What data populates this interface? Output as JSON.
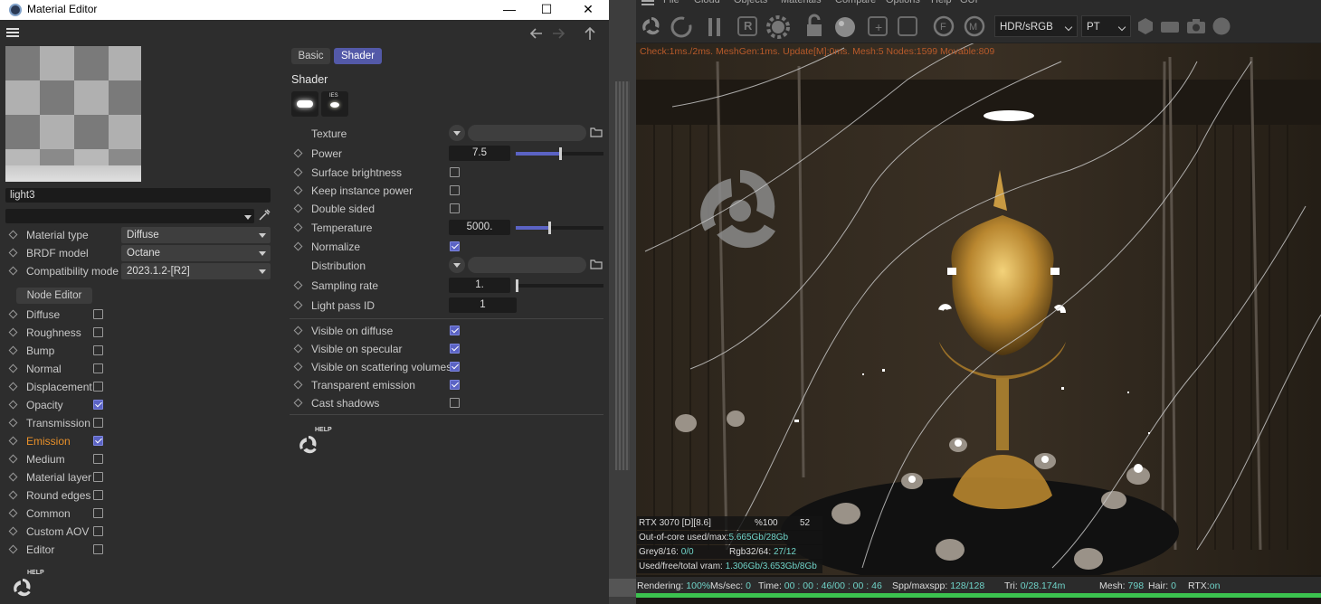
{
  "material_editor": {
    "title": "Material Editor",
    "name_value": "light3",
    "material_type_label": "Material type",
    "material_type_value": "Diffuse",
    "brdf_label": "BRDF model",
    "brdf_value": "Octane",
    "compat_label": "Compatibility mode",
    "compat_value": "2023.1.2-[R2]",
    "node_editor_label": "Node Editor",
    "channels": [
      {
        "label": "Diffuse",
        "checked": false
      },
      {
        "label": "Roughness",
        "checked": false
      },
      {
        "label": "Bump",
        "checked": false
      },
      {
        "label": "Normal",
        "checked": false
      },
      {
        "label": "Displacement",
        "checked": false
      },
      {
        "label": "Opacity",
        "checked": true
      },
      {
        "label": "Transmission",
        "checked": false
      },
      {
        "label": "Emission",
        "checked": true,
        "active": true
      },
      {
        "label": "Medium",
        "checked": false
      },
      {
        "label": "Material layer",
        "checked": false
      },
      {
        "label": "Round edges",
        "checked": false
      },
      {
        "label": "Common",
        "checked": false
      },
      {
        "label": "Custom AOV",
        "checked": false
      },
      {
        "label": "Editor",
        "checked": false
      }
    ],
    "help_label": "HELP",
    "tabs": {
      "basic": "Basic",
      "shader": "Shader"
    },
    "shader_heading": "Shader",
    "ies_label": "IES",
    "texture_label": "Texture",
    "power_label": "Power",
    "power_value": "7.5",
    "power_level": 0.5,
    "surface_brightness_label": "Surface brightness",
    "keep_instance_power_label": "Keep instance power",
    "double_sided_label": "Double sided",
    "temperature_label": "Temperature",
    "temperature_value": "5000.",
    "temperature_level": 0.38,
    "normalize_label": "Normalize",
    "distribution_label": "Distribution",
    "sampling_rate_label": "Sampling rate",
    "sampling_rate_value": "1.",
    "light_pass_label": "Light pass ID",
    "light_pass_value": "1",
    "visibility": [
      {
        "label": "Visible on diffuse",
        "checked": true
      },
      {
        "label": "Visible on specular",
        "checked": true
      },
      {
        "label": "Visible on scattering volumes",
        "checked": true
      },
      {
        "label": "Transparent emission",
        "checked": true
      },
      {
        "label": "Cast shadows",
        "checked": false
      }
    ],
    "accent_color": "#5b63c4",
    "emission_color": "#e8902a"
  },
  "viewer": {
    "menu": [
      "File",
      "Cloud",
      "Objects",
      "Materials",
      "Compare",
      "Options",
      "Help",
      "GUI"
    ],
    "color_space": "HDR/sRGB",
    "kernel": "PT",
    "status_line": "Check:1ms./2ms. MeshGen:1ms. Update[M]:0ms. Mesh:5 Nodes:1599 Movable:809",
    "gpu": "RTX 3070 [D][8.6]",
    "gpu_percent": "%100",
    "gpu_temp": "52",
    "out_of_core_label": "Out-of-core used/max:",
    "out_of_core_value": "5.665Gb/28Gb",
    "grey_label": "Grey8/16:",
    "grey_value": "0/0",
    "rgb_label": "Rgb32/64:",
    "rgb_value": "27/12",
    "vram_label": "Used/free/total vram:",
    "vram_value": "1.306Gb/3.653Gb/8Gb",
    "rendering_label": "Rendering:",
    "rendering_value": "100%",
    "ms_label": "Ms/sec:",
    "ms_value": "0",
    "time_label": "Time:",
    "time_value": "00 : 00 : 46/00 : 00 : 46",
    "spp_label": "Spp/maxspp:",
    "spp_value": "128/128",
    "tri_label": "Tri:",
    "tri_value": "0/28.174m",
    "mesh_label": "Mesh:",
    "mesh_value": "798",
    "hair_label": "Hair:",
    "hair_value": "0",
    "rtx_label": "RTX:",
    "rtx_value": "on",
    "progress": 1.0
  }
}
